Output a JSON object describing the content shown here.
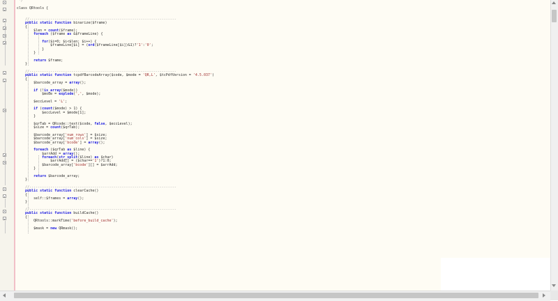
{
  "colors": {
    "keyword": "#1c1ce0",
    "comment": "#9a9a9a",
    "string": "#a03030",
    "background": "#fefcf4",
    "margin_line": "#f2c0c8"
  },
  "editor": {
    "lines": [
      [
        {
          "t": " */",
          "c": "c"
        }
      ],
      [],
      [
        {
          "t": "class QRtools {"
        }
      ],
      [],
      [],
      [
        {
          "t": "    "
        },
        {
          "t": "//----------------------------------------------------------------------",
          "c": "c"
        }
      ],
      [
        {
          "t": "    "
        },
        {
          "t": "public static function",
          "c": "k"
        },
        {
          "t": " binarize($frame)"
        }
      ],
      [
        {
          "t": "    {"
        }
      ],
      [
        {
          "t": "        $len = "
        },
        {
          "t": "count",
          "c": "k"
        },
        {
          "t": "($frame);"
        }
      ],
      [
        {
          "t": "        "
        },
        {
          "t": "foreach",
          "c": "k"
        },
        {
          "t": " ($frame "
        },
        {
          "t": "as",
          "c": "k"
        },
        {
          "t": " &$frameLine) {"
        }
      ],
      [],
      [
        {
          "t": "            "
        },
        {
          "t": "for",
          "c": "k"
        },
        {
          "t": "($i=0; $i<$len; $i++) {"
        }
      ],
      [
        {
          "t": "                $frameLine[$i] = ("
        },
        {
          "t": "ord",
          "c": "k"
        },
        {
          "t": "($frameLine[$i])&1)?"
        },
        {
          "t": "'1'",
          "c": "s"
        },
        {
          "t": ":"
        },
        {
          "t": "'0'",
          "c": "s"
        },
        {
          "t": ";"
        }
      ],
      [
        {
          "t": "            }"
        }
      ],
      [
        {
          "t": "        }"
        }
      ],
      [],
      [
        {
          "t": "        "
        },
        {
          "t": "return",
          "c": "k"
        },
        {
          "t": " $frame;"
        }
      ],
      [
        {
          "t": "    }"
        }
      ],
      [],
      [
        {
          "t": "    "
        },
        {
          "t": "//----------------------------------------------------------------------",
          "c": "c"
        }
      ],
      [
        {
          "t": "    "
        },
        {
          "t": "public static function",
          "c": "k"
        },
        {
          "t": " tcpdfBarcodeArray($code, $mode = "
        },
        {
          "t": "'QR,L'",
          "c": "s"
        },
        {
          "t": ", $tcPdfVersion = "
        },
        {
          "t": "'4.5.037'",
          "c": "s"
        },
        {
          "t": ")"
        }
      ],
      [
        {
          "t": "    {"
        }
      ],
      [
        {
          "t": "        $barcode_array = "
        },
        {
          "t": "array",
          "c": "k"
        },
        {
          "t": "();"
        }
      ],
      [],
      [
        {
          "t": "        "
        },
        {
          "t": "if",
          "c": "k"
        },
        {
          "t": " (!"
        },
        {
          "t": "is_array",
          "c": "k"
        },
        {
          "t": "($mode))"
        }
      ],
      [
        {
          "t": "            $mode = "
        },
        {
          "t": "explode",
          "c": "k"
        },
        {
          "t": "("
        },
        {
          "t": "','",
          "c": "s"
        },
        {
          "t": ", $mode);"
        }
      ],
      [],
      [
        {
          "t": "        $eccLevel = "
        },
        {
          "t": "'L'",
          "c": "s"
        },
        {
          "t": ";"
        }
      ],
      [],
      [
        {
          "t": "        "
        },
        {
          "t": "if",
          "c": "k"
        },
        {
          "t": " ("
        },
        {
          "t": "count",
          "c": "k"
        },
        {
          "t": "($mode) > 1) {"
        }
      ],
      [
        {
          "t": "            $eccLevel = $mode[1];"
        }
      ],
      [
        {
          "t": "        }"
        }
      ],
      [],
      [
        {
          "t": "        $qrTab = QRcode::text($code, "
        },
        {
          "t": "false",
          "c": "k"
        },
        {
          "t": ", $eccLevel);"
        }
      ],
      [
        {
          "t": "        $size = "
        },
        {
          "t": "count",
          "c": "k"
        },
        {
          "t": "($qrTab);"
        }
      ],
      [],
      [
        {
          "t": "        $barcode_array["
        },
        {
          "t": "'num_rows'",
          "c": "s"
        },
        {
          "t": "] = $size;"
        }
      ],
      [
        {
          "t": "        $barcode_array["
        },
        {
          "t": "'num_cols'",
          "c": "s"
        },
        {
          "t": "] = $size;"
        }
      ],
      [
        {
          "t": "        $barcode_array["
        },
        {
          "t": "'bcode'",
          "c": "s"
        },
        {
          "t": "] = "
        },
        {
          "t": "array",
          "c": "k"
        },
        {
          "t": "();"
        }
      ],
      [],
      [
        {
          "t": "        "
        },
        {
          "t": "foreach",
          "c": "k"
        },
        {
          "t": " ($qrTab "
        },
        {
          "t": "as",
          "c": "k"
        },
        {
          "t": " $line) {"
        }
      ],
      [
        {
          "t": "            $arrAdd = "
        },
        {
          "t": "array",
          "c": "k"
        },
        {
          "t": "();"
        }
      ],
      [
        {
          "t": "            "
        },
        {
          "t": "foreach",
          "c": "k"
        },
        {
          "t": "("
        },
        {
          "t": "str_split",
          "c": "k"
        },
        {
          "t": "($line) "
        },
        {
          "t": "as",
          "c": "k"
        },
        {
          "t": " $char)"
        }
      ],
      [
        {
          "t": "                $arrAdd[] = ($char=="
        },
        {
          "t": "'1'",
          "c": "s"
        },
        {
          "t": ")?1:0;"
        }
      ],
      [
        {
          "t": "            $barcode_array["
        },
        {
          "t": "'bcode'",
          "c": "s"
        },
        {
          "t": "][] = $arrAdd;"
        }
      ],
      [
        {
          "t": "        }"
        }
      ],
      [],
      [
        {
          "t": "        "
        },
        {
          "t": "return",
          "c": "k"
        },
        {
          "t": " $barcode_array;"
        }
      ],
      [
        {
          "t": "    }"
        }
      ],
      [],
      [
        {
          "t": "    "
        },
        {
          "t": "//----------------------------------------------------------------------",
          "c": "c"
        }
      ],
      [
        {
          "t": "    "
        },
        {
          "t": "public static function",
          "c": "k"
        },
        {
          "t": " clearCache()"
        }
      ],
      [
        {
          "t": "    {"
        }
      ],
      [
        {
          "t": "        self::$frames = "
        },
        {
          "t": "array",
          "c": "k"
        },
        {
          "t": "();"
        }
      ],
      [
        {
          "t": "    }"
        }
      ],
      [],
      [
        {
          "t": "    "
        },
        {
          "t": "//----------------------------------------------------------------------",
          "c": "c"
        }
      ],
      [
        {
          "t": "    "
        },
        {
          "t": "public static function",
          "c": "k"
        },
        {
          "t": " buildCache()"
        }
      ],
      [
        {
          "t": "    {"
        }
      ],
      [
        {
          "t": "        QRtools::markTime("
        },
        {
          "t": "'before_build_cache'",
          "c": "s"
        },
        {
          "t": ");"
        }
      ],
      [],
      [
        {
          "t": "        $mask = "
        },
        {
          "t": "new",
          "c": "k"
        },
        {
          "t": " QRmask();"
        }
      ]
    ],
    "folds": [
      {
        "line": 0,
        "symbol": "minus"
      },
      {
        "line": 2,
        "symbol": "minus"
      },
      {
        "line": 5,
        "symbol": "minus"
      },
      {
        "line": 7,
        "symbol": "minus"
      },
      {
        "line": 9,
        "symbol": "minus"
      },
      {
        "line": 11,
        "symbol": "minus"
      },
      {
        "line": 19,
        "symbol": "minus"
      },
      {
        "line": 21,
        "symbol": "minus"
      },
      {
        "line": 29,
        "symbol": "minus"
      },
      {
        "line": 41,
        "symbol": "minus"
      },
      {
        "line": 43,
        "symbol": "minus"
      },
      {
        "line": 50,
        "symbol": "minus"
      },
      {
        "line": 52,
        "symbol": "minus"
      },
      {
        "line": 56,
        "symbol": "minus"
      },
      {
        "line": 58,
        "symbol": "minus"
      }
    ]
  }
}
